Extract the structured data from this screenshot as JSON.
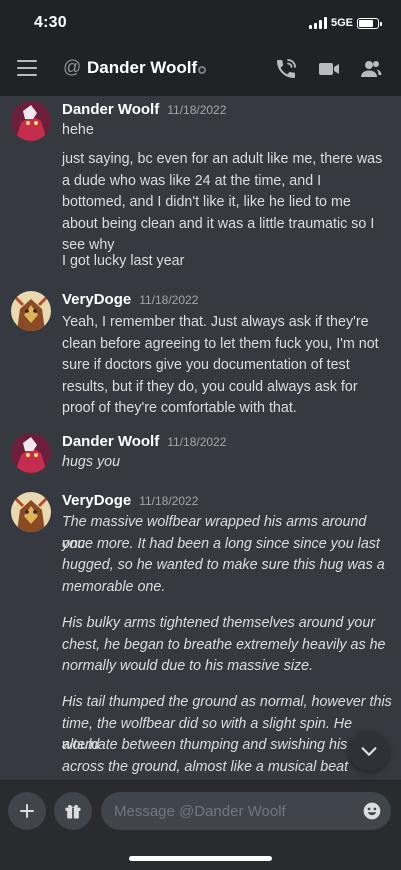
{
  "status_bar": {
    "time": "4:30",
    "network": "5GE"
  },
  "header": {
    "channel_name": "Dander Woolf"
  },
  "messages": [
    {
      "author": "Dander Woolf",
      "timestamp": "11/18/2022",
      "lines": [
        "hehe",
        "just saying, bc even for an adult like me, there was",
        "a dude who was like 24 at the time, and I",
        "bottomed, and I didn't like it, like he lied to me",
        "about being clean and it was a little traumatic so I",
        "see why",
        "I got lucky last year"
      ]
    },
    {
      "author": "VeryDoge",
      "timestamp": "11/18/2022",
      "lines": [
        "Yeah, I remember that. Just always ask if they're",
        "clean before agreeing to let them fuck you, I'm not",
        "sure if doctors give you documentation of test",
        "results, but if they do, you could always ask for",
        "proof of they're comfortable with that."
      ]
    },
    {
      "author": "Dander Woolf",
      "timestamp": "11/18/2022",
      "lines": [
        "hugs you"
      ]
    },
    {
      "author": "VeryDoge",
      "timestamp": "11/18/2022",
      "lines": [
        "The massive wolfbear wrapped his arms around you",
        "once more. It had been a long since since you last",
        "hugged, so he wanted to make sure this hug was a",
        "memorable one.",
        "His bulky arms tightened themselves around your",
        "chest, he began to breathe extremely heavily as he",
        "normally would due to his massive size.",
        "His tail thumped the ground as normal, however this",
        "time, the wolfbear did so with a slight spin. He would",
        "alternate between thumping and swishing his tail",
        "across the ground, almost like a musical beat against"
      ]
    }
  ],
  "composer": {
    "placeholder": "Message @Dander Woolf"
  },
  "icons": {
    "menu": "hamburger-menu-icon",
    "call": "phone-call-icon",
    "video": "video-camera-icon",
    "members": "members-icon",
    "add": "plus-icon",
    "gift": "gift-icon",
    "emoji": "emoji-icon",
    "scroll": "chevron-down-icon"
  },
  "colors": {
    "background": "#36393f",
    "header": "#202225",
    "composer": "#292b2f",
    "input": "#40444b"
  }
}
